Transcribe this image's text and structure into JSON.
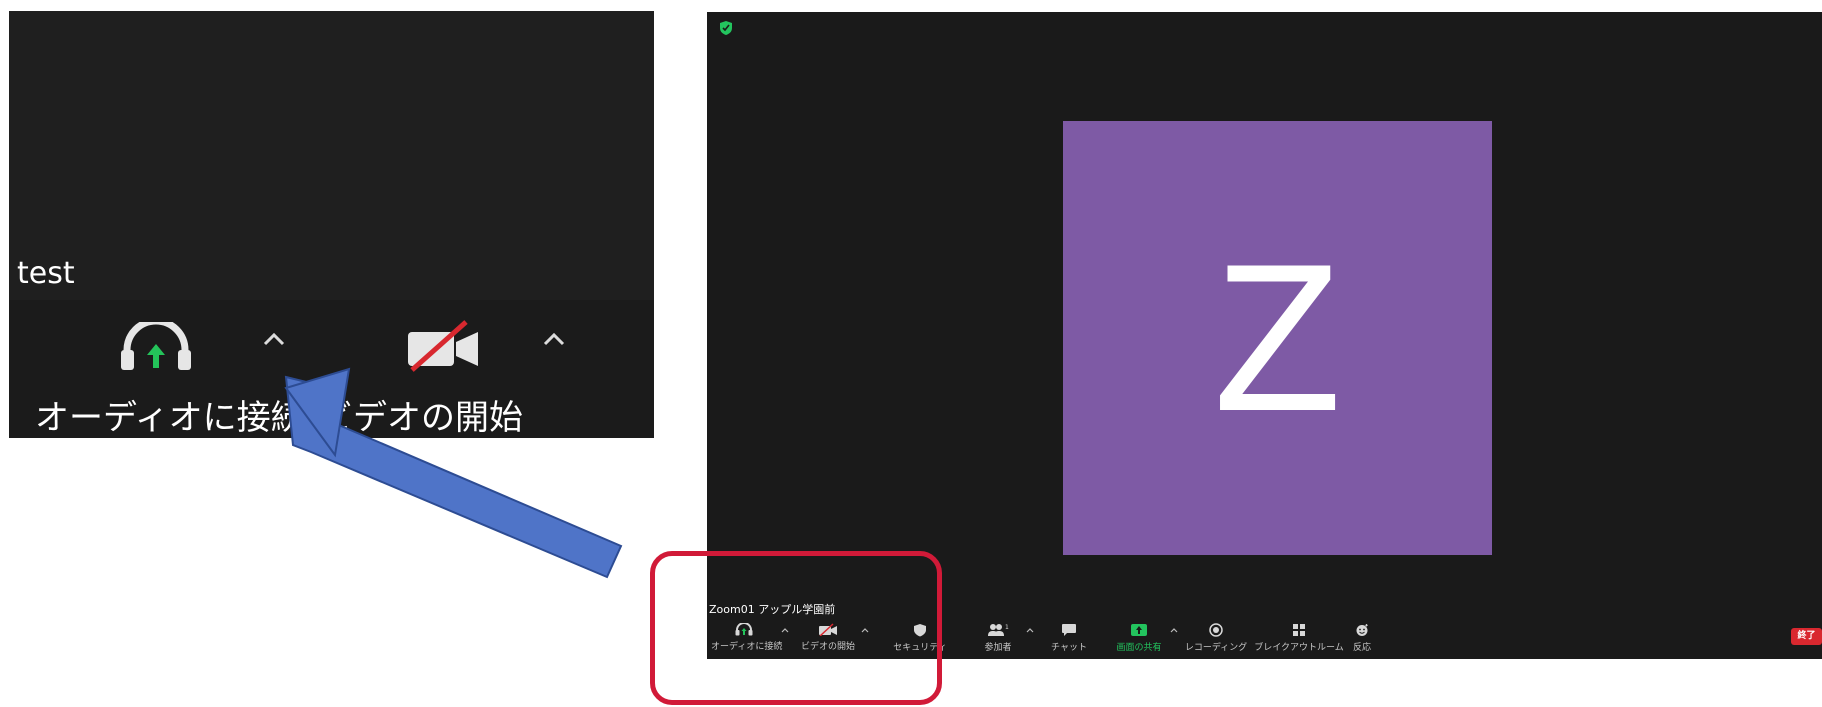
{
  "inset": {
    "participant_name": "test",
    "audio_label": "オーディオに接続",
    "video_label": "ビデオの開始"
  },
  "meeting": {
    "avatar_letter": "Z",
    "participant_name": "Zoom01 アップル学園前",
    "participants_count": "1",
    "toolbar": {
      "audio": "オーディオに接続",
      "video": "ビデオの開始",
      "security": "セキュリティ",
      "participants": "参加者",
      "chat": "チャット",
      "share": "画面の共有",
      "record": "レコーディング",
      "breakout": "ブレイクアウトルーム",
      "reactions": "反応",
      "end": "終了"
    }
  },
  "colors": {
    "window_bg": "#1a1a1a",
    "avatar_bg": "#7e5aa5",
    "share_green": "#23c45e",
    "end_red": "#d9282f",
    "annotation_red": "#d11a38",
    "arrow_blue": "#4f74c8"
  },
  "icons": [
    "headphones-icon",
    "video-off-icon",
    "caret-up-icon",
    "shield-icon",
    "participants-icon",
    "chat-icon",
    "share-screen-icon",
    "record-icon",
    "breakout-icon",
    "reactions-icon"
  ]
}
